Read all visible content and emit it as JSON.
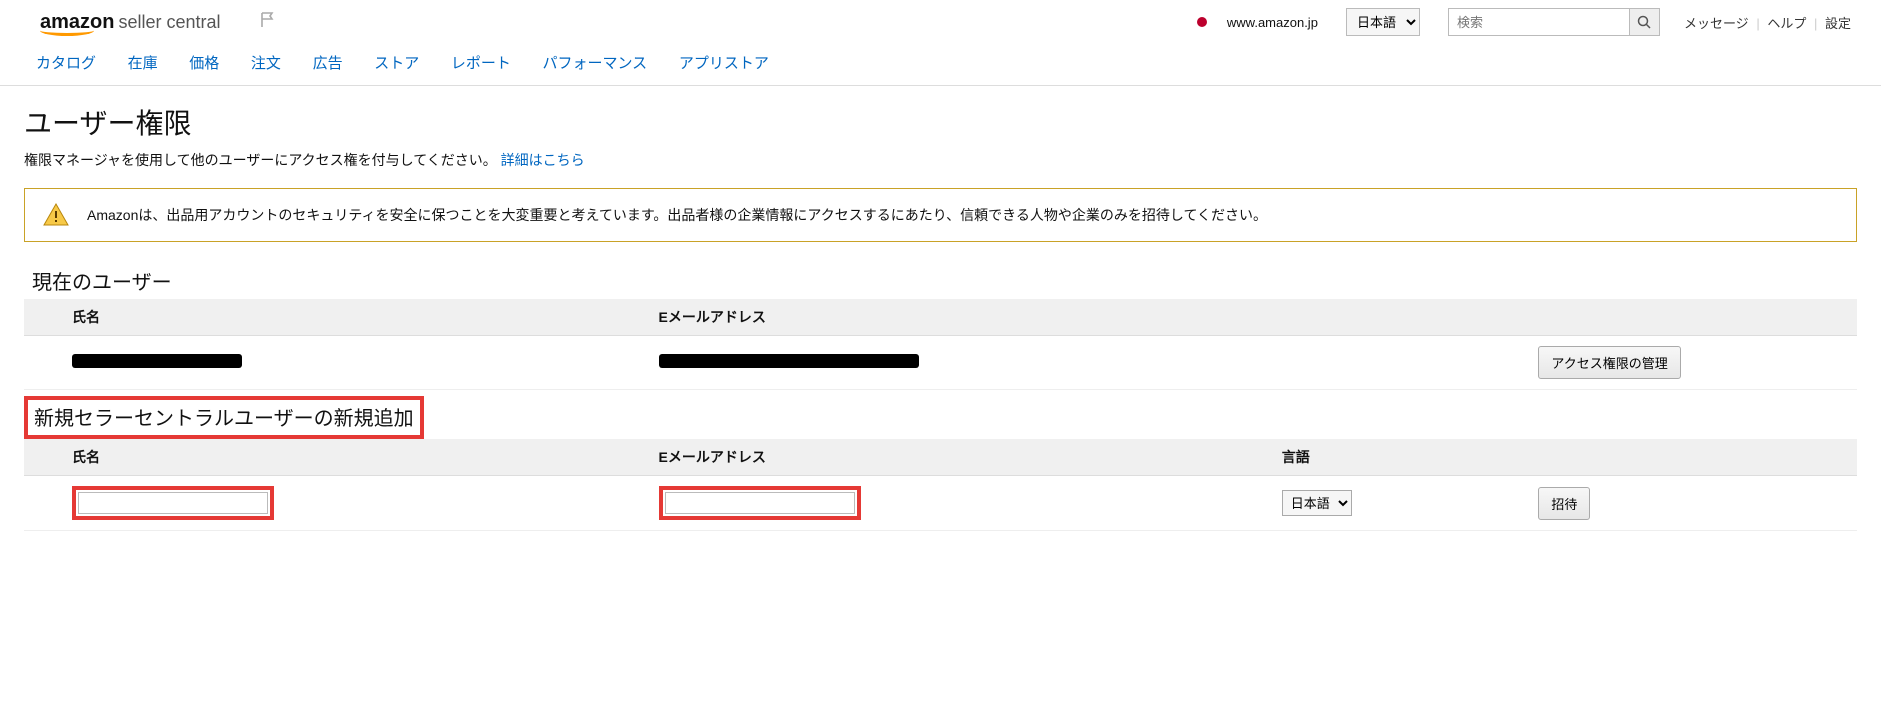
{
  "header": {
    "logo_main": "amazon",
    "logo_sub": "seller central",
    "domain": "www.amazon.jp",
    "lang_selected": "日本語",
    "search_placeholder": "検索",
    "links": {
      "messages": "メッセージ",
      "help": "ヘルプ",
      "settings": "設定"
    }
  },
  "nav": {
    "items": [
      "カタログ",
      "在庫",
      "価格",
      "注文",
      "広告",
      "ストア",
      "レポート",
      "パフォーマンス",
      "アプリストア"
    ]
  },
  "page": {
    "title": "ユーザー権限",
    "subtitle_text": "権限マネージャを使用して他のユーザーにアクセス権を付与してください。",
    "subtitle_link": "詳細はこちら"
  },
  "alert": {
    "text": "Amazonは、出品用アカウントのセキュリティを安全に保つことを大変重要と考えています。出品者様の企業情報にアクセスするにあたり、信頼できる人物や企業のみを招待してください。"
  },
  "current_users": {
    "section_title": "現在のユーザー",
    "cols": {
      "name": "氏名",
      "email": "Eメールアドレス"
    },
    "manage_btn": "アクセス権限の管理"
  },
  "add_user": {
    "section_title": "新規セラーセントラルユーザーの新規追加",
    "cols": {
      "name": "氏名",
      "email": "Eメールアドレス",
      "lang": "言語"
    },
    "lang_selected": "日本語",
    "invite_btn": "招待"
  }
}
